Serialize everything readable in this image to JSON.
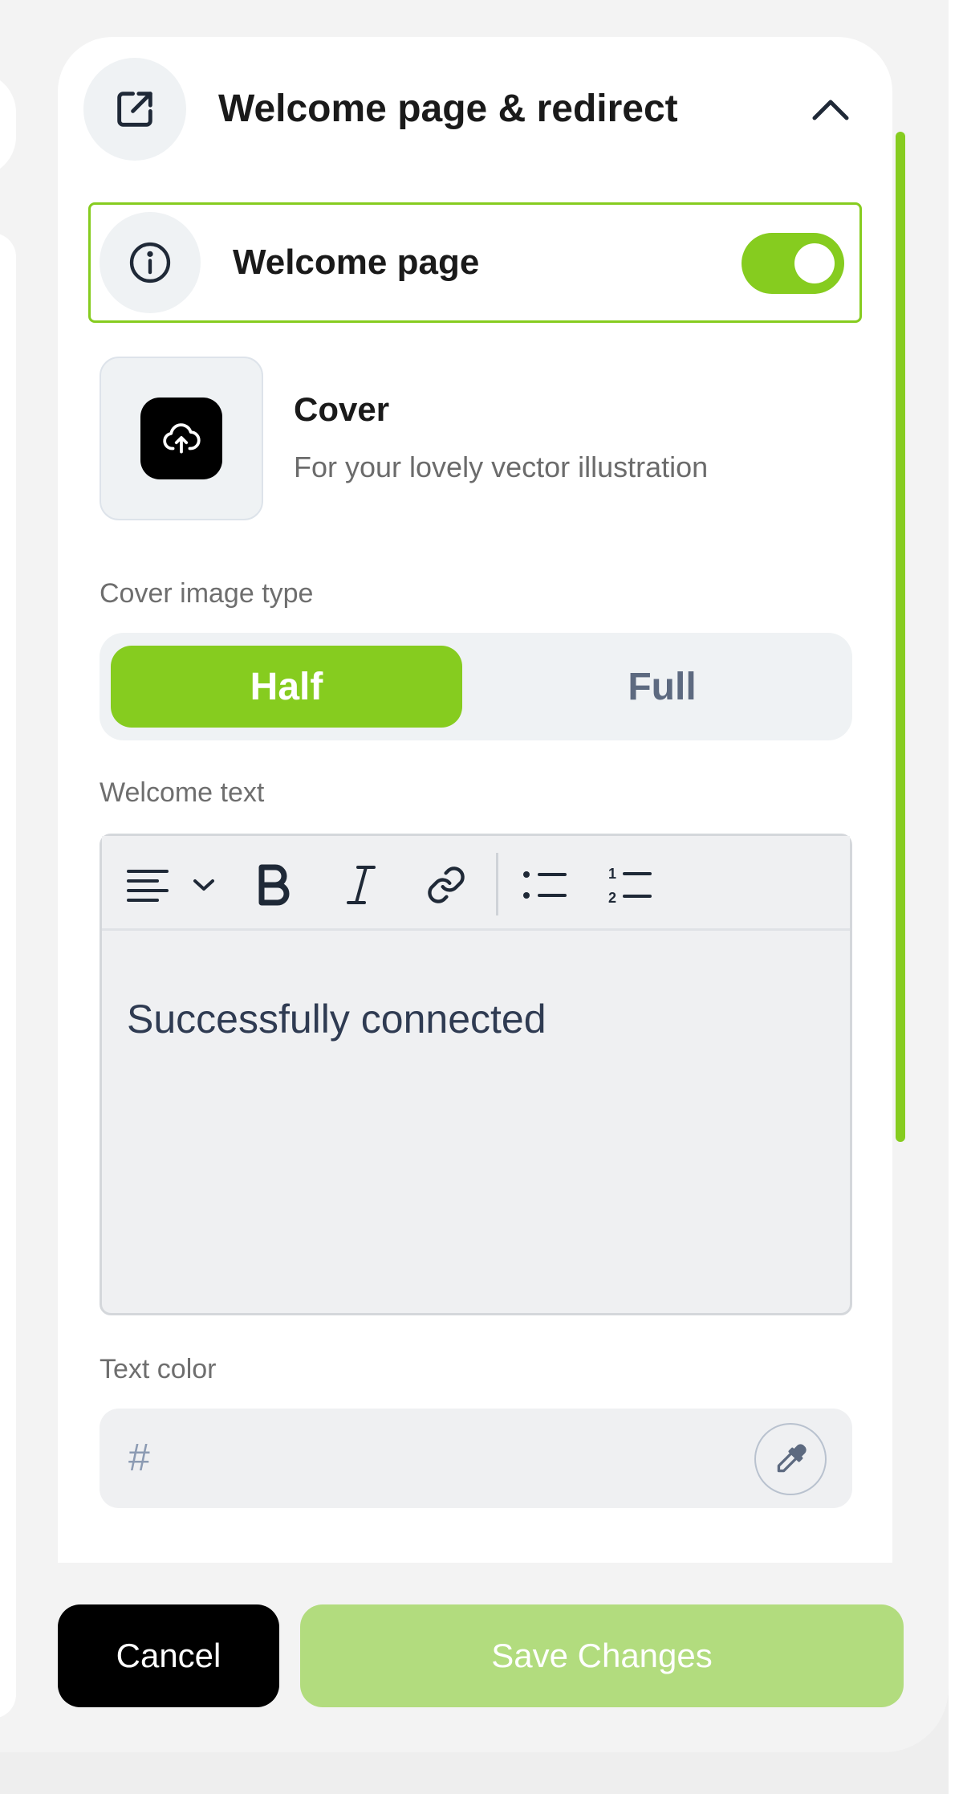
{
  "colors": {
    "accent": "#86cc1f",
    "save_disabled": "#b2dc7e",
    "panel_bg": "#eff2f4",
    "text_dark": "#1a1a1a",
    "text_muted": "#6e6e6e"
  },
  "section": {
    "title": "Welcome page & redirect",
    "icon": "external-link-icon",
    "expanded": true
  },
  "welcome_page": {
    "label": "Welcome page",
    "icon": "info-icon",
    "enabled": true
  },
  "cover": {
    "title": "Cover",
    "subtitle": "For your lovely vector illustration",
    "icon": "cloud-upload-icon"
  },
  "cover_image_type": {
    "label": "Cover image type",
    "options": [
      "Half",
      "Full"
    ],
    "selected": "Half"
  },
  "welcome_text": {
    "label": "Welcome text",
    "content": "Successfully connected",
    "toolbar": [
      "align-left-icon",
      "chevron-down-icon",
      "bold-icon",
      "italic-icon",
      "link-icon",
      "bullet-list-icon",
      "numbered-list-icon"
    ]
  },
  "text_color": {
    "label": "Text color",
    "prefix": "#",
    "value": "",
    "icon": "eyedropper-icon"
  },
  "actions": {
    "cancel": "Cancel",
    "save": "Save Changes"
  }
}
